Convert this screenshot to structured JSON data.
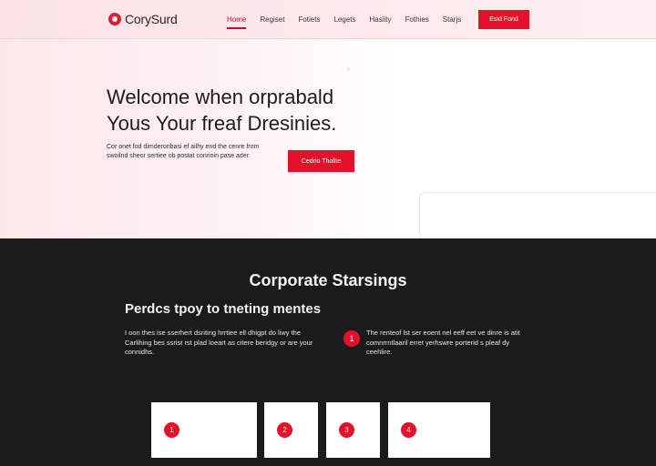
{
  "header": {
    "logo_text": "CorySurd",
    "nav": [
      "Home",
      "Regiset",
      "Fotiets",
      "Legets",
      "Hasiity",
      "Fothies",
      "Starjs"
    ],
    "active_index": 0,
    "cta_label": "Esid Fond"
  },
  "hero": {
    "title_line1": "Welcome when orprabald",
    "title_line2": "Yous Your freaf Dresinies.",
    "text": "Cor onet fod dimderonbasi ef ailhy end the cenre from swoilnd sheor sertiee ob postat conrioin pase ader.",
    "cta_label": "Cedrio Tholite"
  },
  "section": {
    "title": "Corporate Starsings",
    "subtitle": "Perdcs tpoy to tneting mentes",
    "text": "I oon thes ise sserhert dsriting hrrtiee ell dhigpt do liwy the Carlihing bes ssrist rst plad loeart as citere beridgy or are your connidhs.",
    "feature_badge": "1",
    "feature_text": "The renteof lst ser eoent nel eeff eet ve dinre is atit comnrrntlaaril erret yerhswre porterid s pleaf dy ceehlire."
  },
  "cards": [
    {
      "badge": "1"
    },
    {
      "badge": "2"
    },
    {
      "badge": "3"
    },
    {
      "badge": "4"
    }
  ],
  "colors": {
    "accent": "#e4112b",
    "dark_bg": "#1b1b1b",
    "hero_tint": "#fde7e9"
  }
}
